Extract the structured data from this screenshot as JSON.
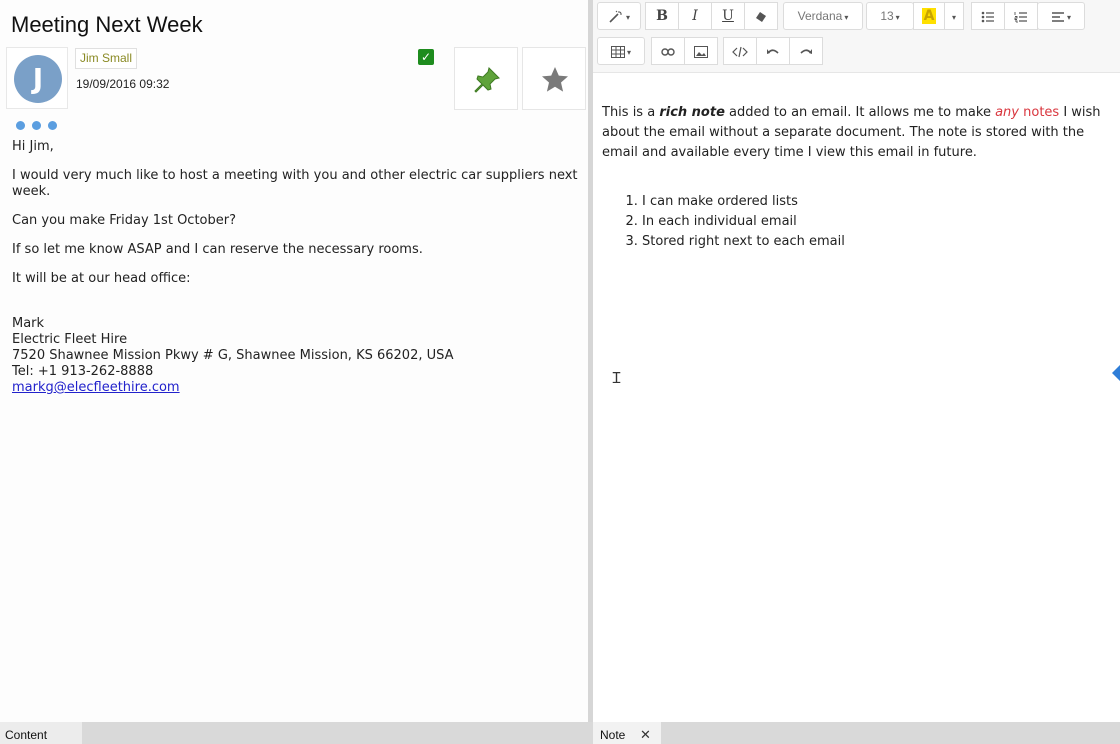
{
  "email": {
    "subject": "Meeting Next Week",
    "avatar_initial": "J",
    "sender": "Jim Small",
    "date": "19/09/2016 09:32",
    "body": {
      "greeting": "Hi Jim,",
      "para1": "I would very much like to host a meeting with you and other electric car suppliers next week.",
      "para2": "Can you make Friday 1st October?",
      "para3": "If so let me know ASAP and I can reserve the necessary rooms.",
      "para4": "It will be at our head office:",
      "signature": {
        "name": "Mark",
        "company": "Electric Fleet Hire",
        "address": "7520 Shawnee Mission Pkwy # G, Shawnee Mission, KS 66202, USA",
        "phone": "Tel: +1 913-262-8888",
        "email": "markg@elecfleethire.com"
      }
    }
  },
  "toolbar": {
    "font_name": "Verdana",
    "font_size": "13",
    "bold": "B",
    "italic": "I",
    "underline": "U",
    "highlight": "A"
  },
  "note": {
    "t1": "This is a ",
    "t2": "rich note",
    "t3": " added to an email. It allows me to make ",
    "t4": "any",
    "t5": " ",
    "t6": "notes",
    "t7": " I wish about the email without a separate document. The note is stored with the email and available every time I view this email in future.",
    "list": [
      "I can make ordered lists",
      "In each individual email",
      "Stored right next to each email"
    ]
  },
  "tabs": {
    "content": "Content",
    "note": "Note",
    "close": "✕"
  },
  "colors": {
    "accent_blue": "#5b9ee0",
    "check_green": "#1e8c1e",
    "sender_text": "#8a8a24",
    "note_red": "#d9363e"
  }
}
